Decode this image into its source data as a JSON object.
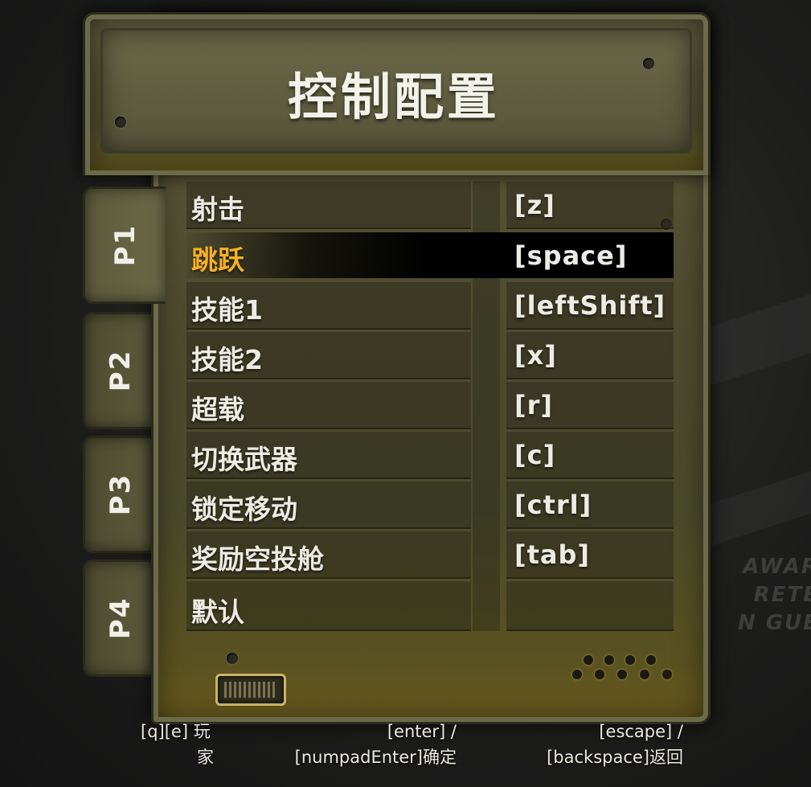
{
  "title": "控制配置",
  "tabs": [
    {
      "label": "P1",
      "active": true
    },
    {
      "label": "P2",
      "active": false
    },
    {
      "label": "P3",
      "active": false
    },
    {
      "label": "P4",
      "active": false
    }
  ],
  "bindings": [
    {
      "action": "射击",
      "key": "[z]"
    },
    {
      "action": "跳跃",
      "key": "[space]",
      "selected": true
    },
    {
      "action": "技能1",
      "key": "[leftShift]"
    },
    {
      "action": "技能2",
      "key": "[x]"
    },
    {
      "action": "超载",
      "key": "[r]"
    },
    {
      "action": "切换武器",
      "key": "[c]"
    },
    {
      "action": "锁定移动",
      "key": "[ctrl]"
    },
    {
      "action": "奖励空投舱",
      "key": "[tab]"
    },
    {
      "action": "默认",
      "key": ""
    }
  ],
  "footer": {
    "player_hint_line1": "[q][e] 玩",
    "player_hint_line2": "家",
    "confirm_hint_line1": "[enter] /",
    "confirm_hint_line2": "[numpadEnter]确定",
    "back_hint_line1": "[escape] /",
    "back_hint_line2": "[backspace]返回"
  },
  "background_text": [
    "AWAR",
    "RETE",
    "N GUE"
  ],
  "colors": {
    "selected_text": "#f5b024",
    "text": "#ecece4",
    "panel": "#4f4c2f"
  }
}
